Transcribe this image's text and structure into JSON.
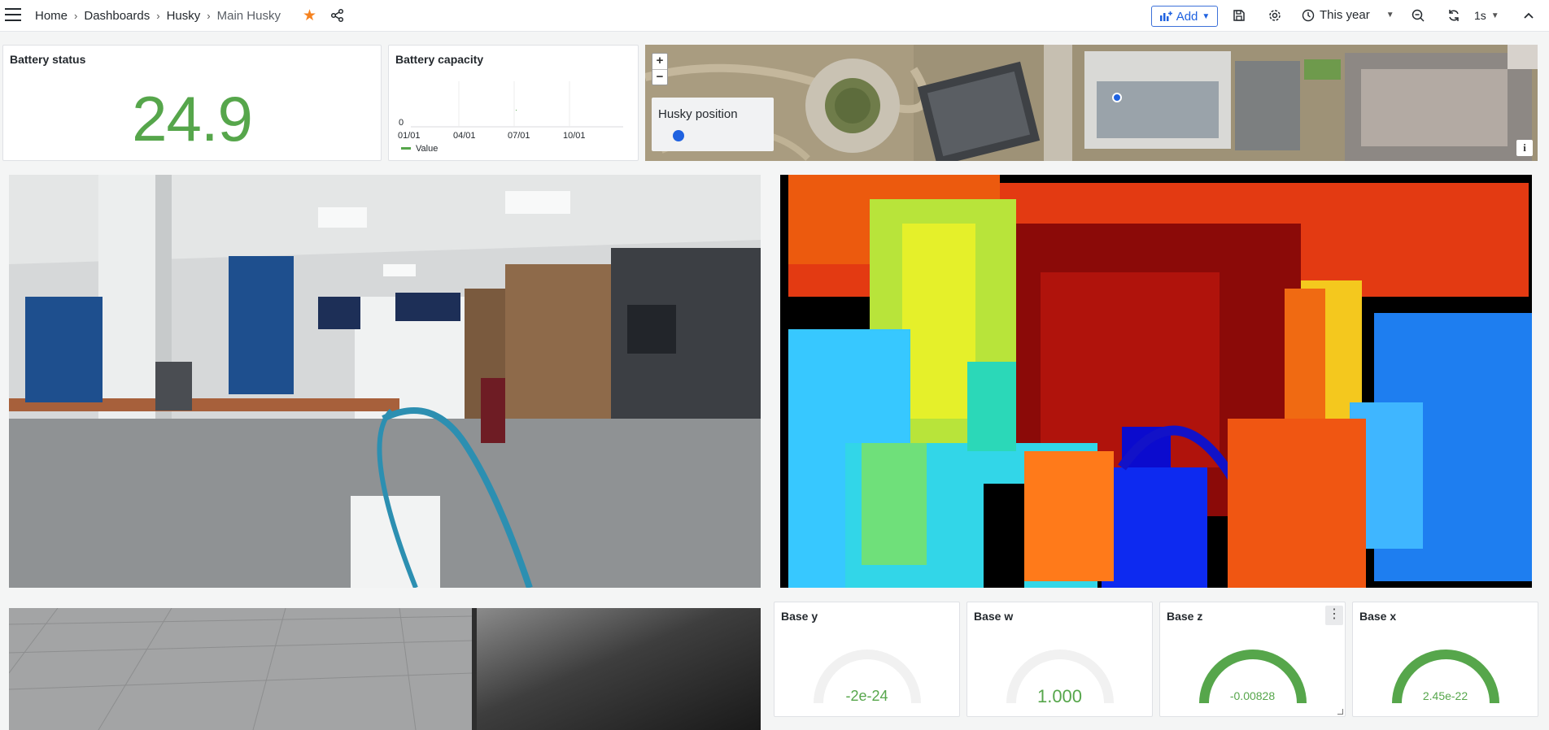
{
  "breadcrumb": {
    "items": [
      "Home",
      "Dashboards",
      "Husky"
    ],
    "current": "Main Husky"
  },
  "toolbar": {
    "add_label": "Add",
    "time_range": "This year",
    "refresh_interval": "1s"
  },
  "panels": {
    "battery_status": {
      "title": "Battery status",
      "value": "24.9",
      "color": "#56a64b"
    },
    "battery_capacity": {
      "title": "Battery capacity",
      "legend": "Value",
      "y_tick": "0",
      "x_ticks": [
        "01/01",
        "04/01",
        "07/01",
        "10/01"
      ]
    },
    "map": {
      "legend_title": "Husky position",
      "zoom_in": "+",
      "zoom_out": "−",
      "info": "i"
    },
    "gauges": [
      {
        "title": "Base y",
        "value": "-2e-24",
        "fill": 0
      },
      {
        "title": "Base w",
        "value": "1.000",
        "fill": 0
      },
      {
        "title": "Base z",
        "value": "-0.00828",
        "fill": 1
      },
      {
        "title": "Base x",
        "value": "2.45e-22",
        "fill": 1
      }
    ]
  },
  "colors": {
    "accent": "#1f62e0",
    "green": "#56a64b",
    "favorite": "#f5821f"
  }
}
